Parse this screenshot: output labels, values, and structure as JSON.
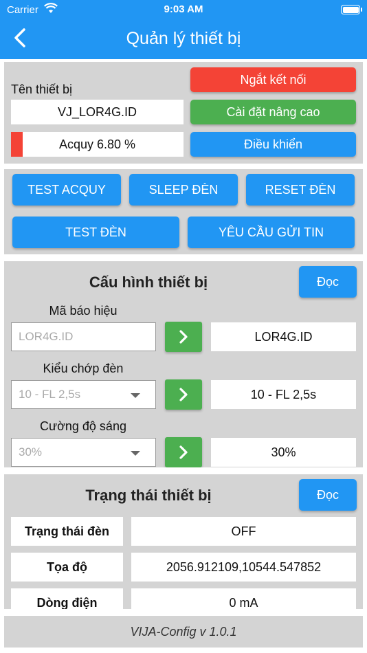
{
  "status_bar": {
    "carrier": "Carrier",
    "time": "9:03 AM"
  },
  "header": {
    "title": "Quản lý thiết bị",
    "back_icon": "chevron-left-icon"
  },
  "device": {
    "name_label": "Tên thiết bị",
    "name_value": "VJ_LOR4G.ID",
    "battery_text": "Acquy 6.80 %",
    "battery_level_percent": 6.8,
    "disconnect_label": "Ngắt kết nối",
    "advanced_label": "Cài đặt nâng cao",
    "control_label": "Điều khiển"
  },
  "actions": {
    "test_battery": "TEST ACQUY",
    "sleep_light": "SLEEP ĐÈN",
    "reset_light": "RESET ĐÈN",
    "test_light": "TEST ĐÈN",
    "request_send": "YÊU CẦU GỬI TIN"
  },
  "config": {
    "title": "Cấu hình thiết bị",
    "read_label": "Đọc",
    "signal_code_label": "Mã báo hiệu",
    "signal_code_placeholder": "LOR4G.ID",
    "signal_code_value": "LOR4G.ID",
    "flash_mode_label": "Kiểu chớp đèn",
    "flash_mode_selected": "10 - FL 2,5s",
    "flash_mode_value": "10 - FL 2,5s",
    "brightness_label": "Cường độ sáng",
    "brightness_selected": "30%",
    "brightness_value": "30%"
  },
  "status": {
    "title": "Trạng thái thiết bị",
    "read_label": "Đọc",
    "rows": [
      {
        "label": "Trạng thái đèn",
        "value": "OFF"
      },
      {
        "label": "Tọa độ",
        "value": "2056.912109,10544.547852"
      },
      {
        "label": "Dòng điện",
        "value": "0 mA"
      }
    ]
  },
  "footer": {
    "version": "VIJA-Config v 1.0.1"
  },
  "colors": {
    "primary": "#2196f3",
    "danger": "#f44336",
    "success": "#4caf50",
    "panel": "#d4d4d4"
  }
}
